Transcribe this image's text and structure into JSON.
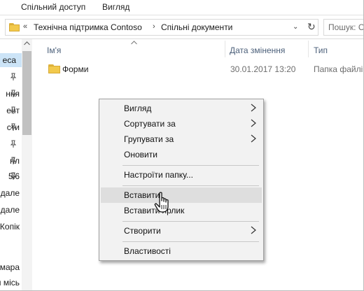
{
  "ribbon": {
    "tabs": [
      "Спільний доступ",
      "Вигляд"
    ]
  },
  "address": {
    "back_chevron": "«",
    "crumbs": [
      "Технічна підтримка Contoso",
      "Спільні документи"
    ],
    "separator": "›",
    "dropdown_glyph": "⌄",
    "refresh_glyph": "↻"
  },
  "search": {
    "placeholder": "Пошук: Спі"
  },
  "nav": {
    "items": [
      "еса",
      "ння",
      "ент",
      "сти",
      "",
      "гіл",
      "5і6",
      "идале",
      "идале",
      "Копік",
      "",
      "мара",
      "я місь"
    ]
  },
  "columns": {
    "name": "Ім'я",
    "date": "Дата змінення",
    "type": "Тип"
  },
  "files": [
    {
      "name": "Форми",
      "date": "30.01.2017 13:20",
      "type": "Папка файлів"
    }
  ],
  "context_menu": {
    "view": "Вигляд",
    "sort_by": "Сортувати за",
    "group_by": "Групувати за",
    "refresh": "Оновити",
    "customize": "Настроїти папку...",
    "paste": "Вставити",
    "paste_shortcut": "Вставити ярлик",
    "new": "Створити",
    "properties": "Властивості"
  }
}
